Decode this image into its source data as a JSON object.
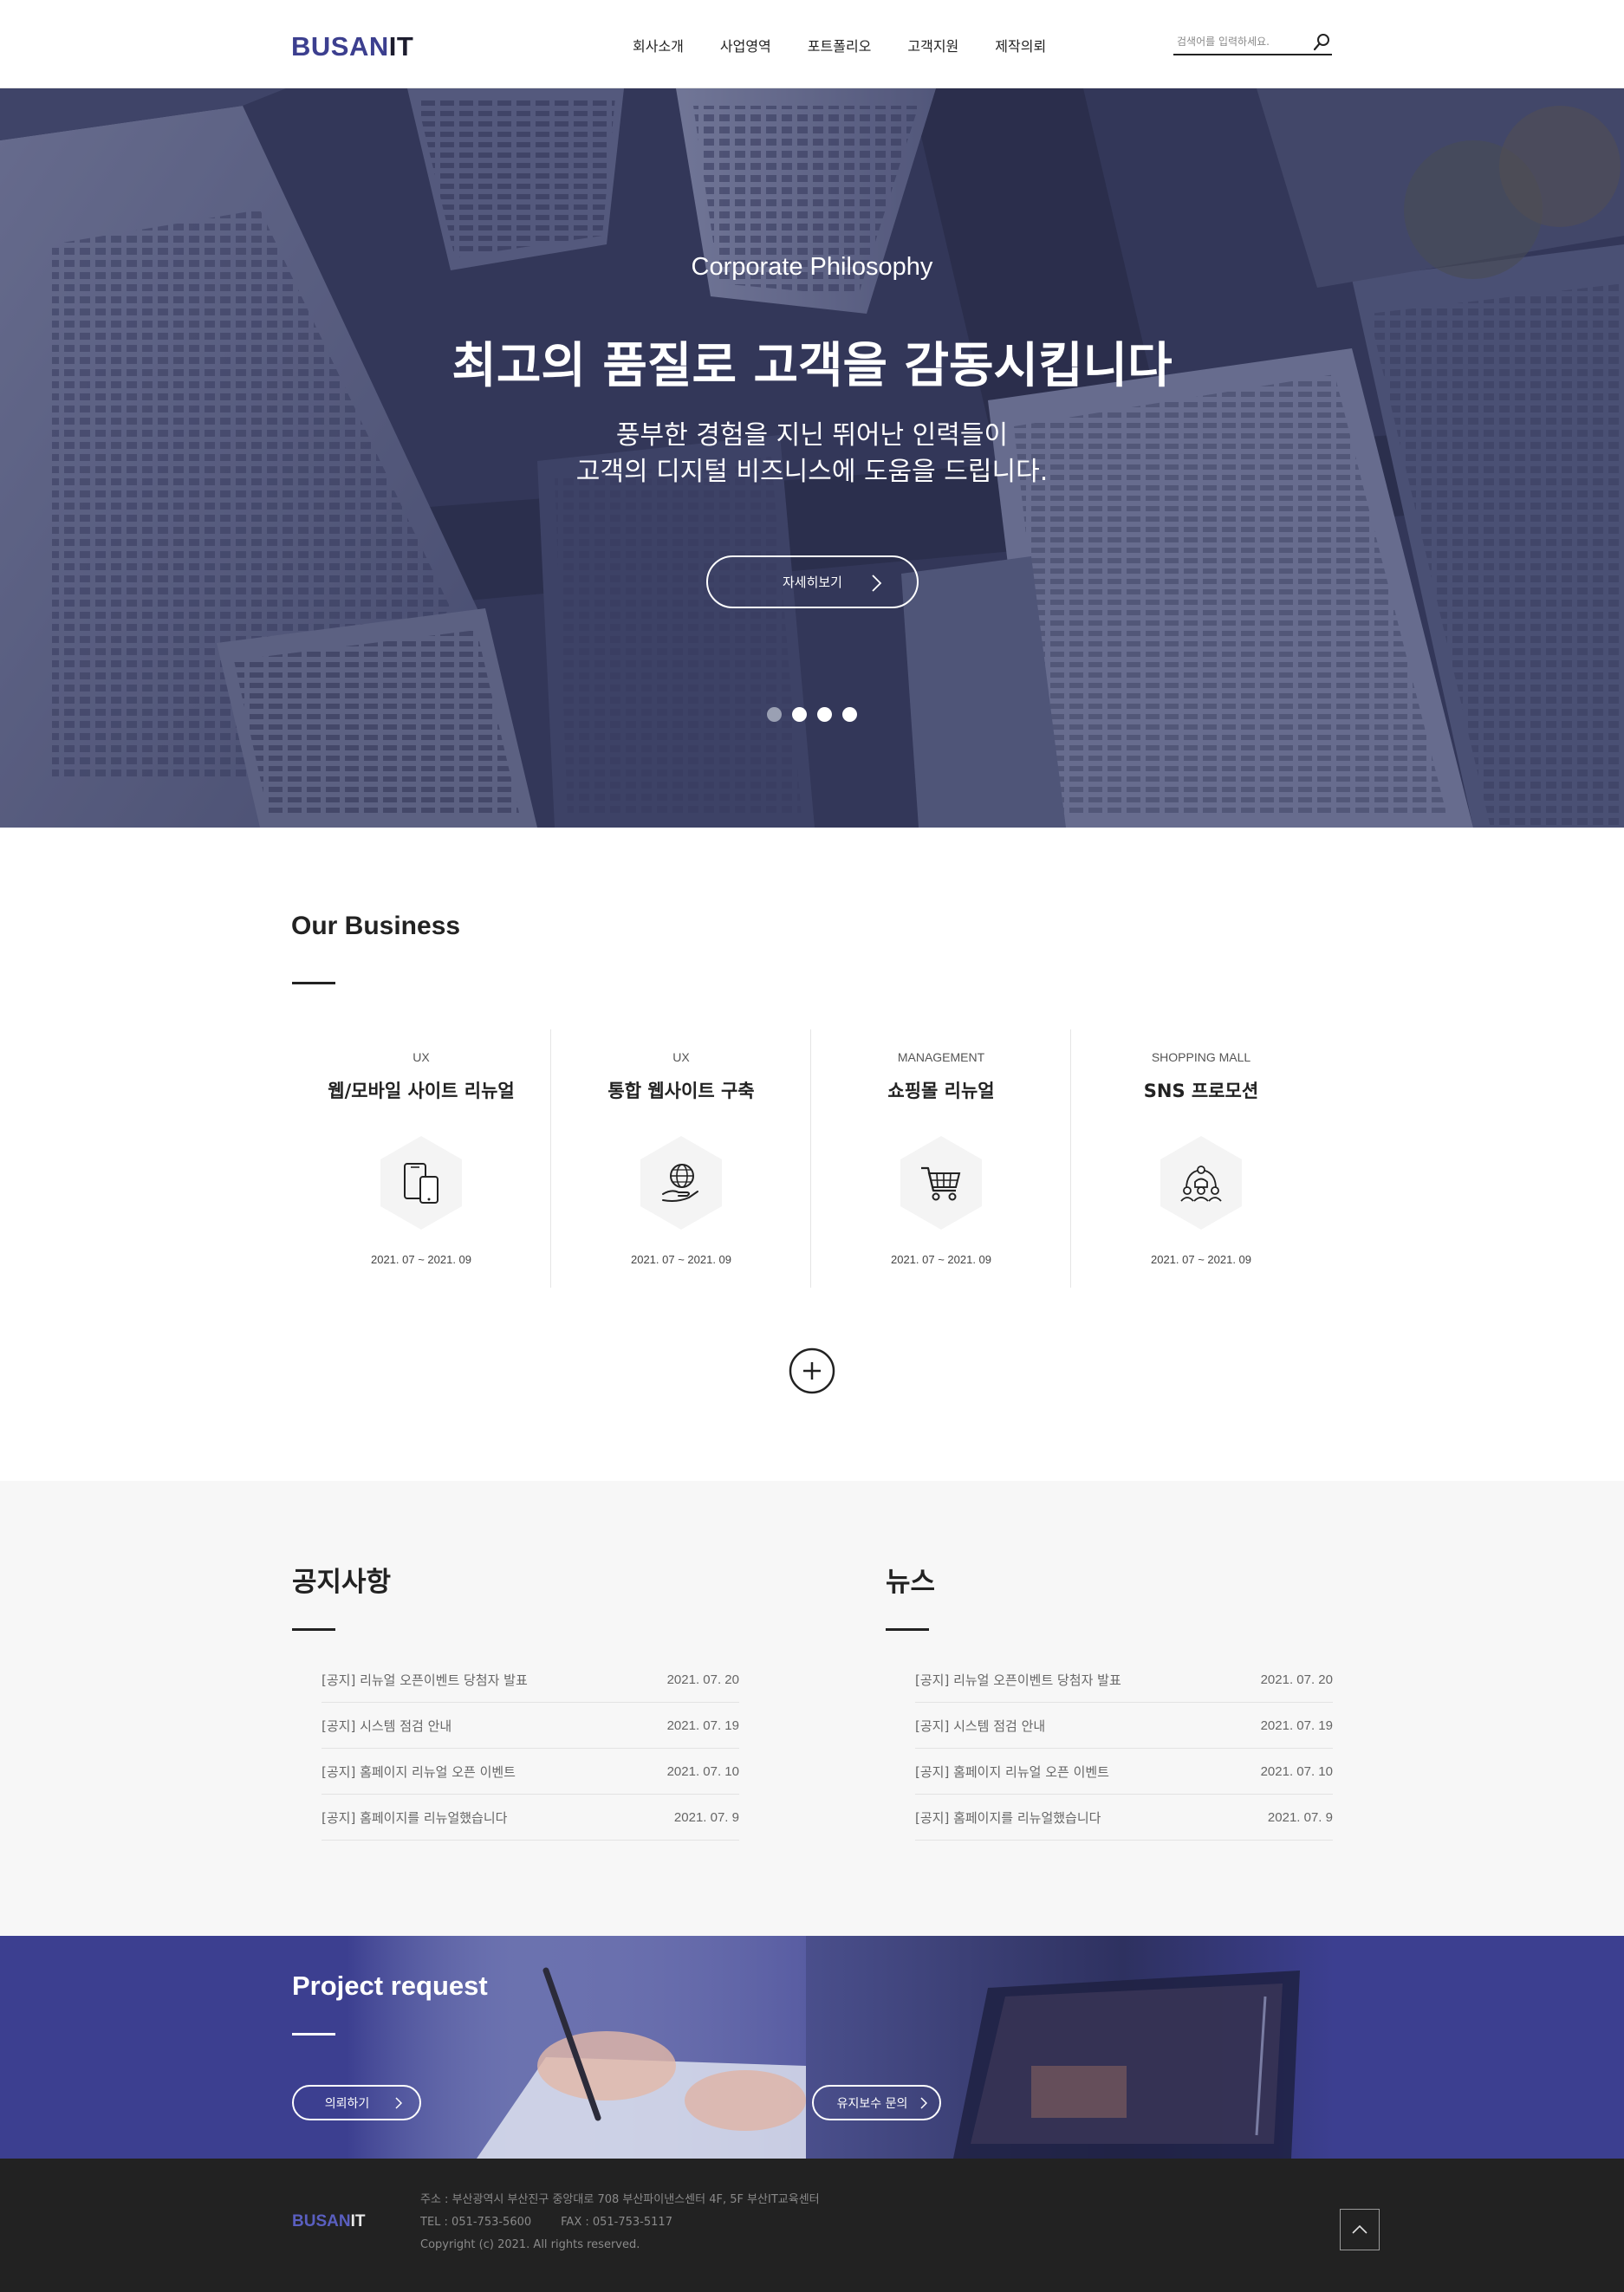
{
  "header": {
    "logo_part1": "BUSAN",
    "logo_part2": "IT",
    "nav": [
      "회사소개",
      "사업영역",
      "포트폴리오",
      "고객지원",
      "제작의뢰"
    ],
    "search_placeholder": "검색어를 입력하세요."
  },
  "hero": {
    "subtitle": "Corporate Philosophy",
    "title": "최고의 품질로 고객을 감동시킵니다",
    "desc_line1": "풍부한 경험을 지닌 뛰어난 인력들이",
    "desc_line2": "고객의 디지털 비즈니스에 도움을 드립니다.",
    "button_label": "자세히보기",
    "slides": 4,
    "active_slide": 1
  },
  "business": {
    "title": "Our Business",
    "cards": [
      {
        "category": "UX",
        "title": "웹/모바일 사이트 리뉴얼",
        "date": "2021. 07 ~ 2021. 09",
        "icon": "mobile-devices-icon"
      },
      {
        "category": "UX",
        "title": "통합 웹사이트 구축",
        "date": "2021. 07 ~ 2021. 09",
        "icon": "globe-hand-icon"
      },
      {
        "category": "MANAGEMENT",
        "title": "쇼핑몰 리뉴얼",
        "date": "2021. 07 ~ 2021. 09",
        "icon": "shopping-cart-icon"
      },
      {
        "category": "SHOPPING MALL",
        "title": "SNS 프로모션",
        "date": "2021. 07 ~ 2021. 09",
        "icon": "network-people-icon"
      }
    ]
  },
  "notice": {
    "title": "공지사항",
    "items": [
      {
        "text": "[공지] 리뉴얼 오픈이벤트 당첨자 발표",
        "date": "2021. 07. 20"
      },
      {
        "text": "[공지] 시스템 점검 안내",
        "date": "2021. 07. 19"
      },
      {
        "text": "[공지] 홈페이지 리뉴얼 오픈 이벤트",
        "date": "2021. 07. 10"
      },
      {
        "text": "[공지] 홈페이지를 리뉴얼했습니다",
        "date": "2021. 07. 9"
      }
    ]
  },
  "news": {
    "title": "뉴스",
    "items": [
      {
        "text": "[공지] 리뉴얼 오픈이벤트 당첨자 발표",
        "date": "2021. 07. 20"
      },
      {
        "text": "[공지] 시스템 점검 안내",
        "date": "2021. 07. 19"
      },
      {
        "text": "[공지] 홈페이지 리뉴얼 오픈 이벤트",
        "date": "2021. 07. 10"
      },
      {
        "text": "[공지] 홈페이지를 리뉴얼했습니다",
        "date": "2021. 07. 9"
      }
    ]
  },
  "project": {
    "title": "Project request",
    "request_button": "의뢰하기",
    "maintenance_button": "유지보수 문의"
  },
  "footer": {
    "logo_part1": "BUSAN",
    "logo_part2": "IT",
    "address": "주소 : 부산광역시 부산진구 중앙대로 708 부산파이낸스센터 4F, 5F 부산IT교육센터",
    "tel": "TEL : 051-753-5600",
    "fax": "FAX : 051-753-5117",
    "copyright": "Copyright (c) 2021. All rights reserved."
  },
  "colors": {
    "brand": "#3c3f8f",
    "project_bg": "#3c3f90",
    "footer_bg": "#222222",
    "board_bg": "#f7f7f7"
  }
}
